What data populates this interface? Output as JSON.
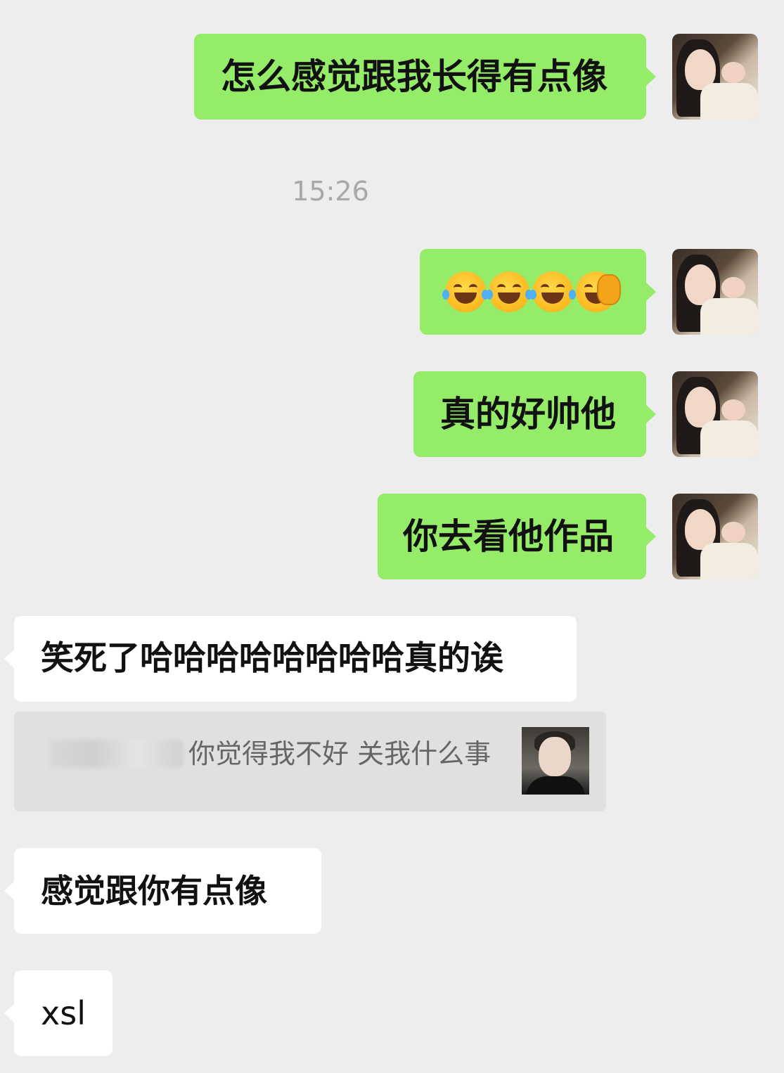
{
  "chat": {
    "messages_out": [
      {
        "text": "怎么感觉跟我长得有点像"
      },
      {
        "emojis": [
          "face-with-tears-of-joy",
          "face-with-tears-of-joy",
          "face-with-tears-of-joy",
          "face-palm"
        ]
      },
      {
        "text": "真的好帅他"
      },
      {
        "text": "你去看他作品"
      }
    ],
    "timestamp": "15:26",
    "messages_in": [
      {
        "text": "笑死了哈哈哈哈哈哈哈哈真的诶"
      },
      {
        "text": "感觉跟你有点像"
      },
      {
        "text": "xsl"
      }
    ],
    "quote": {
      "text": "你觉得我不好 关我什么事"
    }
  },
  "colors": {
    "background": "#ededed",
    "outgoing_bubble": "#95ec69",
    "incoming_bubble": "#ffffff",
    "quote_background": "#e0e0e0",
    "timestamp": "#a8a8a8"
  }
}
